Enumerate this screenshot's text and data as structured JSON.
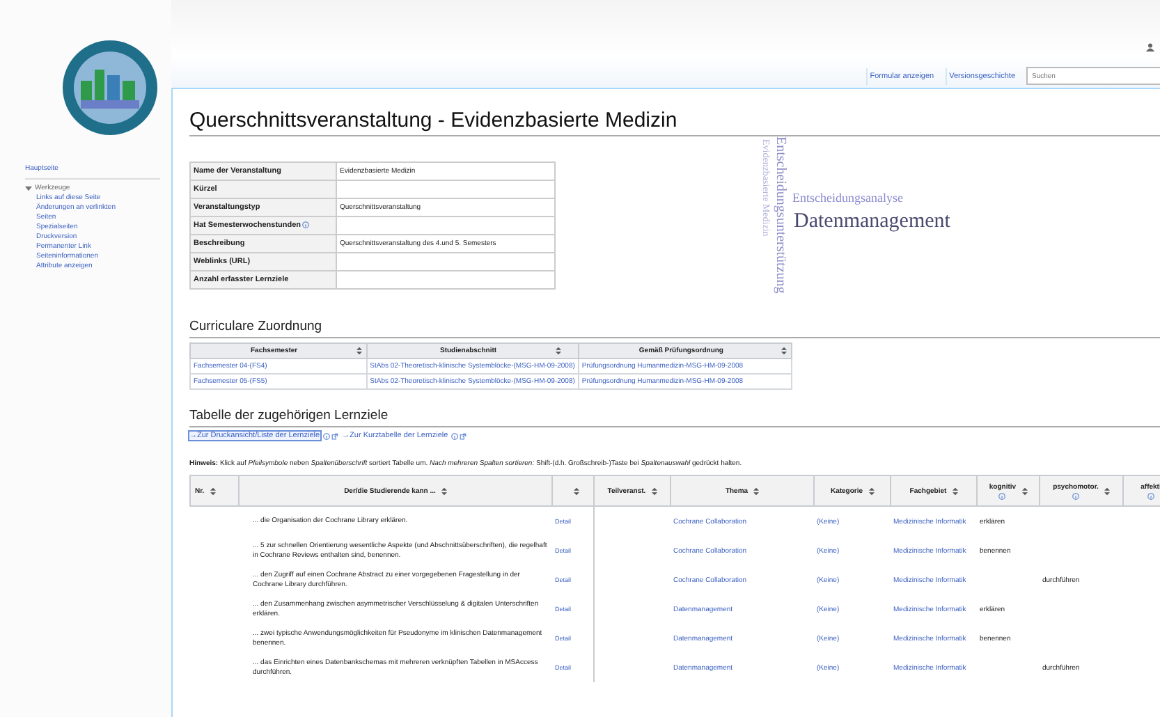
{
  "header": {
    "actions": [
      {
        "label": "Formular anzeigen"
      },
      {
        "label": "Versionsgeschichte"
      }
    ],
    "search": {
      "placeholder": "Suchen"
    }
  },
  "sidebar": {
    "items": [
      {
        "label": "Hauptseite"
      }
    ],
    "section": {
      "label": "Werkzeuge",
      "expanded": true,
      "items": [
        {
          "label": "Links auf diese Seite"
        },
        {
          "label": "Änderungen an verlinkten Seiten"
        },
        {
          "label": "Spezialseiten"
        },
        {
          "label": "Druckversion"
        },
        {
          "label": "Permanenter Link"
        },
        {
          "label": "Seiteninformationen"
        },
        {
          "label": "Attribute anzeigen"
        }
      ]
    }
  },
  "page": {
    "title": "Querschnittsveranstaltung - Evidenzbasierte Medizin"
  },
  "infobox": {
    "rows": [
      {
        "label": "Name der Veranstaltung",
        "value": "Evidenzbasierte Medizin"
      },
      {
        "label": "Kürzel"
      },
      {
        "label": "Veranstaltungstyp",
        "value": "Querschnittsveranstaltung"
      },
      {
        "label": "Hat Semesterwochenstunden",
        "info": true
      },
      {
        "label": "Beschreibung",
        "value": "Querschnittsveranstaltung des 4.und 5. Semesters"
      },
      {
        "label": "Weblinks (URL)"
      },
      {
        "label": "Anzahl erfasster Lernziele"
      }
    ]
  },
  "word_cloud": {
    "words": [
      {
        "text": "Evidenzbasierte Medizin",
        "kind": "vertical"
      },
      {
        "text": "Entscheidungsunterstützung",
        "kind": "vertical"
      },
      {
        "text": "Entscheidungsanalyse",
        "kind": "horizontal"
      },
      {
        "text": "Datenmanagement",
        "kind": "horizontal"
      }
    ]
  },
  "curricular": {
    "heading": "Curriculare Zuordnung",
    "columns": [
      {
        "label": "Fachsemester"
      },
      {
        "label": "Studienabschnitt"
      },
      {
        "label": "Gemäß Prüfungsordnung"
      }
    ],
    "rows": [
      [
        "Fachsemester 04-(FS4)",
        "StAbs 02-Theoretisch-klinische Systemblöcke-(MSG-HM-09-2008)",
        "Prüfungsordnung Humanmedizin-MSG-HM-09-2008"
      ],
      [
        "Fachsemester 05-(FS5)",
        "StAbs 02-Theoretisch-klinische Systemblöcke-(MSG-HM-09-2008)",
        "Prüfungsordnung Humanmedizin-MSG-HM-09-2008"
      ]
    ]
  },
  "objectives": {
    "heading": "Tabelle der zugehörigen Lernziele",
    "links": [
      {
        "label": "→Zur Druckansicht/Liste der Lernziele",
        "selected": true
      },
      {
        "label": "→Zur Kurztabelle der Lernziele",
        "selected": false
      }
    ],
    "note": "**Hinweis:** Klick auf *Pfeilsymbole* neben *Spaltenüberschrift* sortiert Tabelle um. *Nach mehreren Spalten sortieren:* Shift-(d.h. Großschreib-)Taste bei *Spaltenauswahl* gedrückt halten.",
    "columns": [
      {
        "label": "Nr.",
        "sortable": true
      },
      {
        "label": "Der/die Studierende kann ...",
        "sortable": true
      },
      {
        "sortable": true
      },
      {
        "label": "Teilveranst.",
        "sortable": true
      },
      {
        "label": "Thema",
        "sortable": true
      },
      {
        "label": "Kategorie",
        "sortable": true
      },
      {
        "label": "Fachgebiet",
        "sortable": true
      },
      {
        "label": "kognitiv",
        "info": true,
        "sortable": true
      },
      {
        "label": "psychomotor.",
        "info": true,
        "sortable": true
      },
      {
        "label": "affekti",
        "info": true,
        "sortable": false
      }
    ],
    "rows": [
      {
        "objective": "... die Organisation der Cochrane Library  erklären.",
        "details": "Detail",
        "thema": "Cochrane Collaboration",
        "kategorie": "(Keine)",
        "fachgebiet": "Medizinische Informatik",
        "kognitiv": "erklären"
      },
      {
        "objective": "... 5 zur schnellen Orientierung wesentliche Aspekte (und Abschnittsüberschriften), die regelhaft in Cochrane Reviews enthalten sind,  benennen.",
        "details": "Detail",
        "thema": "Cochrane Collaboration",
        "kategorie": "(Keine)",
        "fachgebiet": "Medizinische Informatik",
        "kognitiv": "benennen"
      },
      {
        "objective": "... den Zugriff auf einen Cochrane Abstract zu einer vorgegebenen Fragestellung in der Cochrane Library  durchführen.",
        "details": "Detail",
        "thema": "Cochrane Collaboration",
        "kategorie": "(Keine)",
        "fachgebiet": "Medizinische Informatik",
        "psychomotor": "durchführen"
      },
      {
        "objective": "... den Zusammenhang zwischen asymmetrischer Verschlüsselung & digitalen Unterschriften  erklären.",
        "details": "Detail",
        "thema": "Datenmanagement",
        "kategorie": "(Keine)",
        "fachgebiet": "Medizinische Informatik",
        "kognitiv": "erklären"
      },
      {
        "objective": "... zwei typische Anwendungsmöglichkeiten für Pseudonyme im klinischen Datenmanagement  benennen.",
        "details": "Detail",
        "thema": "Datenmanagement",
        "kategorie": "(Keine)",
        "fachgebiet": "Medizinische Informatik",
        "kognitiv": "benennen"
      },
      {
        "objective": "... das Einrichten eines Datenbankschemas mit mehreren verknüpften Tabellen in MSAccess  durchführen.",
        "details": "Detail",
        "thema": "Datenmanagement",
        "kategorie": "(Keine)",
        "fachgebiet": "Medizinische Informatik",
        "psychomotor": "durchführen"
      }
    ]
  }
}
